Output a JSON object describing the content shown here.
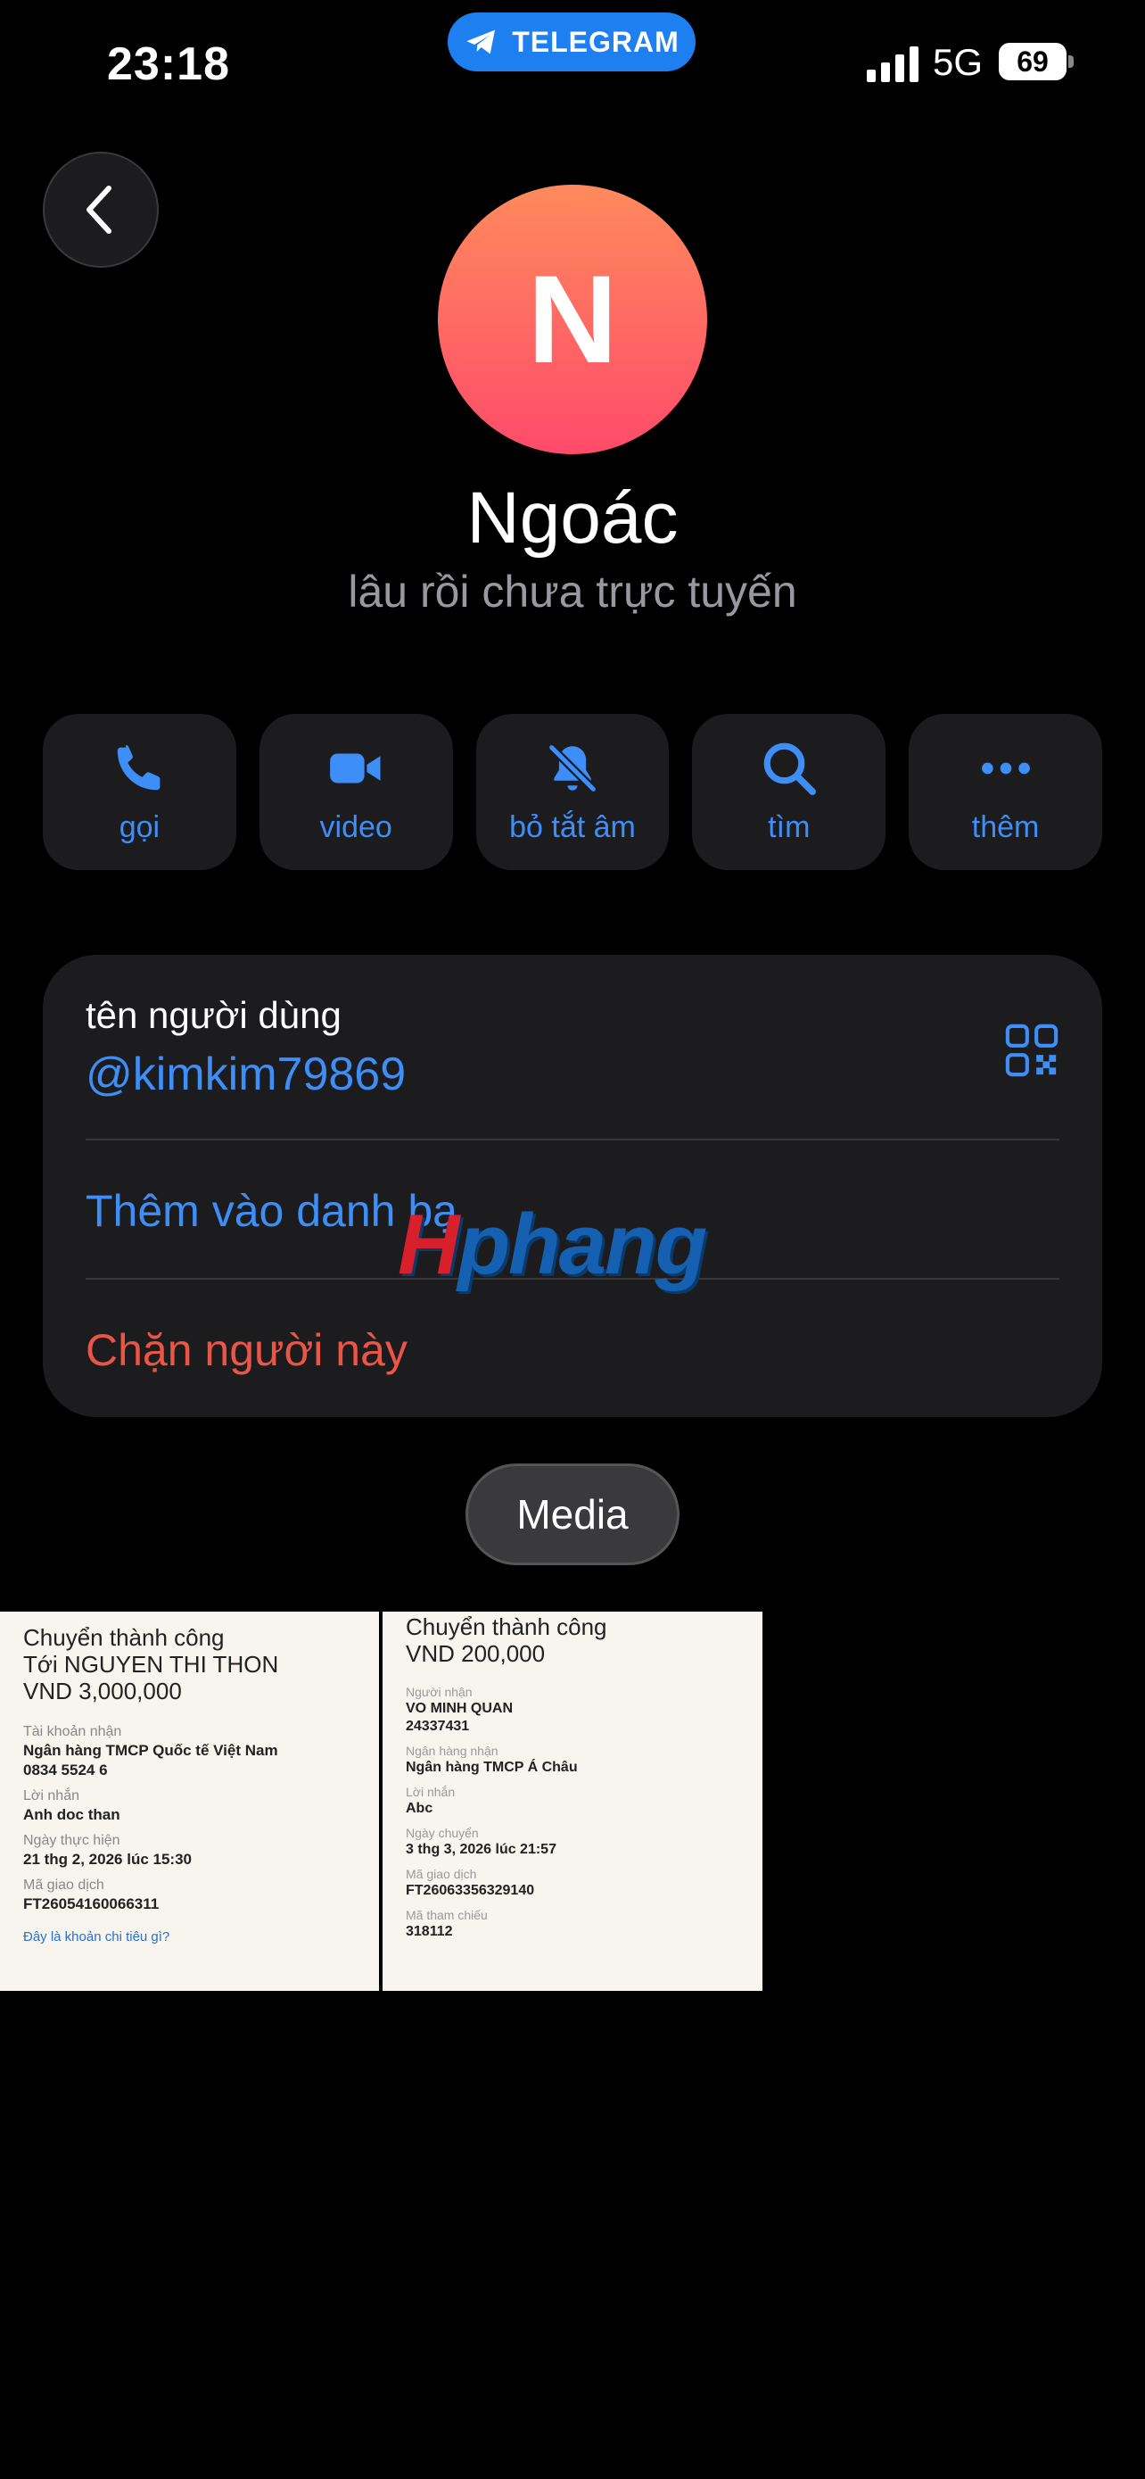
{
  "status_bar": {
    "time": "23:18",
    "app_label": "TELEGRAM",
    "network": "5G",
    "battery": "69"
  },
  "profile": {
    "avatar_letter": "N",
    "name": "Ngoác",
    "status": "lâu rồi chưa trực tuyến"
  },
  "actions": [
    {
      "label": "gọi",
      "icon": "phone-icon"
    },
    {
      "label": "video",
      "icon": "video-icon"
    },
    {
      "label": "bỏ tắt âm",
      "icon": "bell-slash-icon"
    },
    {
      "label": "tìm",
      "icon": "search-icon"
    },
    {
      "label": "thêm",
      "icon": "more-icon"
    }
  ],
  "info": {
    "username_label": "tên người dùng",
    "username": "@kimkim79869",
    "add_contact": "Thêm vào danh bạ",
    "block": "Chặn người này"
  },
  "watermark": {
    "h": "H",
    "rest": "phang"
  },
  "media_tab": "Media",
  "media": [
    {
      "title1": "Chuyển thành công",
      "title2": "Tới NGUYEN THI THON",
      "title3": "VND 3,000,000",
      "f1_label": "Tài khoản nhận",
      "f1_val1": "Ngân hàng TMCP Quốc tế Việt Nam",
      "f1_val2": "0834 5524 6",
      "f2_label": "Lời nhắn",
      "f2_val": "Anh doc than",
      "f3_label": "Ngày thực hiện",
      "f3_val": "21 thg 2, 2026 lúc 15:30",
      "f4_label": "Mã giao dịch",
      "f4_val": "FT26054160066311",
      "link": "Đây là khoản chi tiêu gì?"
    },
    {
      "title1": "Chuyển thành công",
      "title2": "VND 200,000",
      "f1_label": "Người nhận",
      "f1_val1": "VO MINH QUAN",
      "f1_val2": "24337431",
      "f2_label": "Ngân hàng nhận",
      "f2_val": "Ngân hàng TMCP Á Châu",
      "f3_label": "Lời nhắn",
      "f3_val": "Abc",
      "f4_label": "Ngày chuyển",
      "f4_val": "3 thg 3, 2026 lúc 21:57",
      "f5_label": "Mã giao dịch",
      "f5_val": "FT26063356329140",
      "f6_label": "Mã tham chiếu",
      "f6_val": "318112"
    }
  ],
  "colors": {
    "accent": "#3e8ef7",
    "danger": "#eb5545",
    "card": "#1c1c1e",
    "telegram": "#1d7ff0"
  }
}
